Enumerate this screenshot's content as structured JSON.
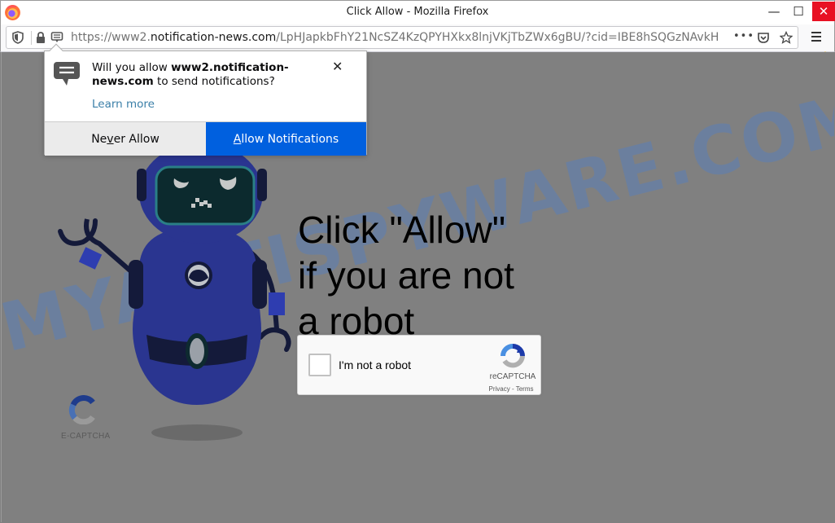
{
  "window": {
    "title": "Click Allow - Mozilla Firefox",
    "minimize_glyph": "—",
    "maximize_glyph": "☐",
    "close_glyph": "✕"
  },
  "urlbar": {
    "scheme": "https://www2.",
    "domain": "notification-news.com",
    "path": "/LpHJapkbFhY21NcSZ4KzQPYHXkx8lnjVKjTbZWx6gBU/?cid=IBE8hSQGzNAvkH",
    "more_glyph": "•••",
    "icons": [
      "shield-icon",
      "lock-icon",
      "notification-icon",
      "pocket-icon",
      "star-icon",
      "hamburger-menu-icon",
      "warning-icon"
    ]
  },
  "popup": {
    "message_prefix": "Will you allow ",
    "message_site": "www2.notification-news.com",
    "message_suffix": " to send notifications?",
    "learn_more": "Learn more",
    "close_glyph": "✕",
    "never_allow": {
      "pre": "Ne",
      "accel": "v",
      "post": "er Allow"
    },
    "allow": {
      "accel": "A",
      "post": "llow Notifications"
    }
  },
  "page": {
    "headline_lines": [
      "Click \"Allow\"",
      "if you are not",
      "a robot"
    ],
    "watermark": "MYANTISPYWARE.COM",
    "recaptcha": {
      "label": "I'm not a robot",
      "brand": "reCAPTCHA",
      "links": "Privacy - Terms",
      "checked": false
    },
    "ecaptcha_label": "E-CAPTCHA"
  },
  "colors": {
    "allow_button": "#0060df",
    "close_button": "#e81123",
    "page_bg": "#808080",
    "robot_blue": "#2a3590",
    "watermark": "#5b7fb8",
    "link": "#3b7fa8"
  }
}
